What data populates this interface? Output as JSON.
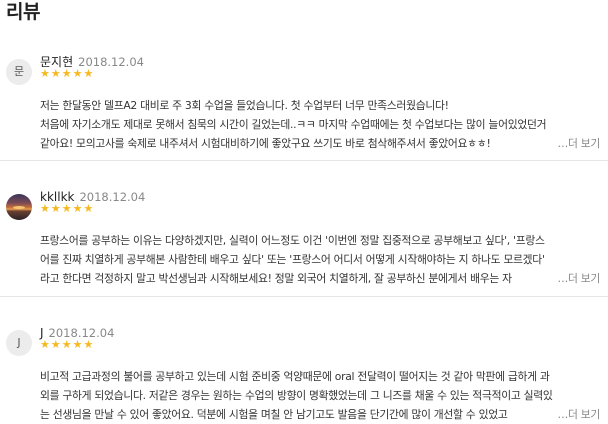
{
  "header": {
    "title": "리뷰"
  },
  "reviews": [
    {
      "avatar_text": "문",
      "name": "문지현",
      "date": "2018.12.04",
      "stars": "★★★★★",
      "lines": [
        "저는 한달동안 델프A2 대비로 주 3회 수업을 들었습니다. 첫 수업부터 너무 만족스러웠습니다!",
        "처음에 자기소개도 제대로 못해서 침묵의 시간이 길었는데..ㅋㅋ 마지막 수업때에는 첫 수업보다는 많이 늘어있었던거",
        "같아요! 모의고사를 숙제로 내주셔서 시험대비하기에 좋았구요 쓰기도 바로 첨삭해주셔서 좋았어요ㅎㅎ!"
      ],
      "more": "…더 보기"
    },
    {
      "avatar_text": "",
      "name": "kkllkk",
      "date": "2018.12.04",
      "stars": "★★★★★",
      "lines": [
        "프랑스어를 공부하는 이유는 다양하겠지만, 실력이 어느정도 이건 '이번엔 정말 집중적으로 공부해보고 싶다', '프랑스",
        "어를 진짜 치열하게 공부해본 사람한테 배우고 싶다' 또는 '프랑스어 어디서 어떻게 시작해야하는 지 하나도 모르겠다'",
        "라고 한다면 걱정하지 말고 박선생님과 시작해보세요! 정말 외국어 치열하게, 잘 공부하신 분에게서 배우는 자"
      ],
      "more": "…더 보기"
    },
    {
      "avatar_text": "J",
      "name": "J",
      "date": "2018.12.04",
      "stars": "★★★★★",
      "lines": [
        "비고적 고급과정의 불어를 공부하고 있는데 시험 준비중 억양때문에 oral 전달력이 떨어지는 것 같아 막판에 급하게 과",
        "외를 구하게 되었습니다. 저같은 경우는 원하는 수업의 방향이 명확했었는데 그 니즈를 채울 수 있는 적극적이고 실력있",
        "는 선생님을 만날 수 있어 좋았어요. 덕분에 시험을 며칠 안 남기고도 발음을 단기간에 많이 개선할 수 있었고"
      ],
      "more": "…더 보기"
    }
  ]
}
